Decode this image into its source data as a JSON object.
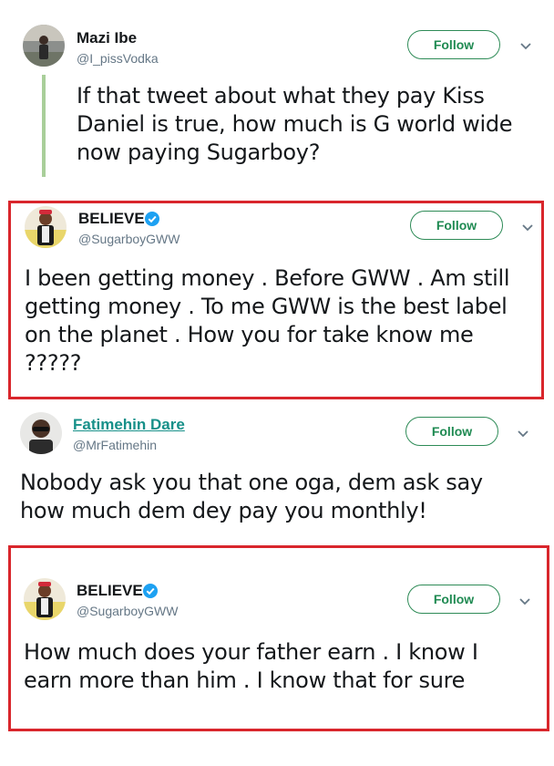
{
  "tweets": [
    {
      "name": "Mazi Ibe",
      "handle": "@I_pissVodka",
      "follow_label": "Follow",
      "verified": false,
      "lines": [
        "If that tweet about what they pay Kiss",
        "Daniel is true, how much is G world wide",
        "now paying Sugarboy?"
      ]
    },
    {
      "name": "BELIEVE",
      "handle": "@SugarboyGWW",
      "follow_label": "Follow",
      "verified": true,
      "lines": [
        "I been getting money . Before GWW . Am still",
        "getting money . To me GWW is the best label",
        "on the planet . How you for take know me",
        "?????"
      ]
    },
    {
      "name": "Fatimehin Dare",
      "handle": "@MrFatimehin",
      "follow_label": "Follow",
      "verified": false,
      "lines": [
        "Nobody ask you that one oga, dem ask say",
        "how much dem dey pay you monthly!"
      ]
    },
    {
      "name": "BELIEVE",
      "handle": "@SugarboyGWW",
      "follow_label": "Follow",
      "verified": true,
      "lines": [
        "How much does your father earn . I know I",
        "earn more than him . I know that for sure"
      ]
    }
  ],
  "colors": {
    "follow_border": "#2e8b57",
    "highlight_box": "#d9262c",
    "thread_line": "#a9cf9a",
    "verified": "#1da1f2"
  }
}
